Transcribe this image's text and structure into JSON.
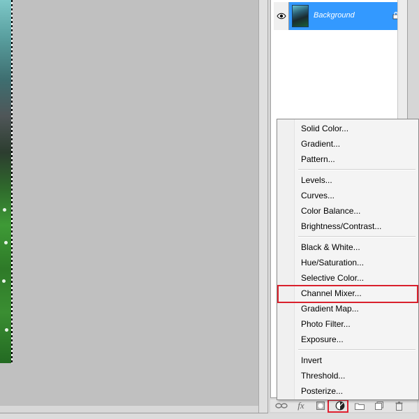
{
  "layers": {
    "items": [
      {
        "name": "Background",
        "visible": true,
        "locked": true,
        "selected": true
      }
    ]
  },
  "adjustment_menu": {
    "groups": [
      [
        "Solid Color...",
        "Gradient...",
        "Pattern..."
      ],
      [
        "Levels...",
        "Curves...",
        "Color Balance...",
        "Brightness/Contrast..."
      ],
      [
        "Black & White...",
        "Hue/Saturation...",
        "Selective Color...",
        "Channel Mixer...",
        "Gradient Map...",
        "Photo Filter...",
        "Exposure..."
      ],
      [
        "Invert",
        "Threshold...",
        "Posterize..."
      ]
    ],
    "highlighted_item": "Channel Mixer..."
  },
  "icon_bar": {
    "icons": [
      "link-layers-icon",
      "fx-icon",
      "add-mask-icon",
      "adjustment-layer-icon",
      "group-folder-icon",
      "new-layer-icon",
      "trash-icon"
    ],
    "fx_label": "fx",
    "highlighted_icon": "adjustment-layer-icon"
  },
  "colors": {
    "selection_blue": "#3399ff",
    "highlight_red": "#d9202c",
    "canvas_gray": "#c0c0c0"
  }
}
